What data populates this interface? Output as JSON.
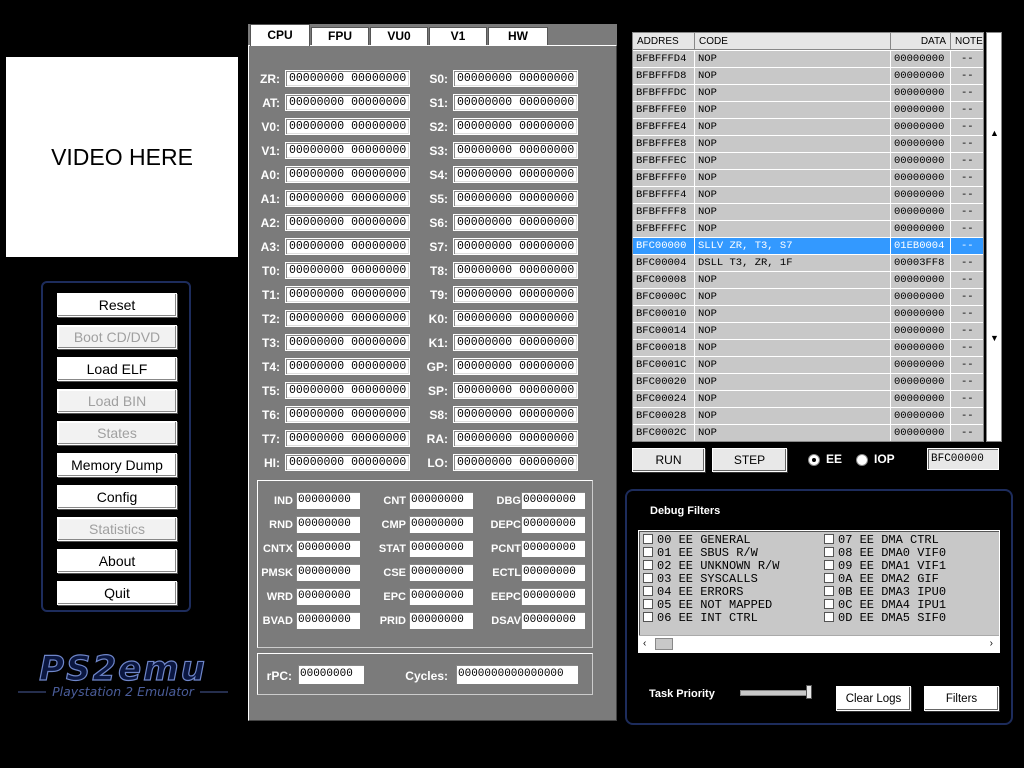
{
  "video": {
    "placeholder": "VIDEO HERE"
  },
  "menu": {
    "reset": "Reset",
    "boot_cd": "Boot CD/DVD",
    "load_elf": "Load ELF",
    "load_bin": "Load BIN",
    "states": "States",
    "memory_dump": "Memory Dump",
    "config": "Config",
    "statistics": "Statistics",
    "about": "About",
    "quit": "Quit"
  },
  "logo": {
    "title": "PS2emu",
    "subtitle": "Playstation 2 Emulator"
  },
  "tabs": [
    "CPU",
    "FPU",
    "VU0",
    "V1",
    "HW"
  ],
  "gpr_left": [
    {
      "label": "ZR:",
      "value": "00000000  00000000"
    },
    {
      "label": "AT:",
      "value": "00000000  00000000"
    },
    {
      "label": "V0:",
      "value": "00000000  00000000"
    },
    {
      "label": "V1:",
      "value": "00000000  00000000"
    },
    {
      "label": "A0:",
      "value": "00000000  00000000"
    },
    {
      "label": "A1:",
      "value": "00000000  00000000"
    },
    {
      "label": "A2:",
      "value": "00000000  00000000"
    },
    {
      "label": "A3:",
      "value": "00000000  00000000"
    },
    {
      "label": "T0:",
      "value": "00000000  00000000"
    },
    {
      "label": "T1:",
      "value": "00000000  00000000"
    },
    {
      "label": "T2:",
      "value": "00000000  00000000"
    },
    {
      "label": "T3:",
      "value": "00000000  00000000"
    },
    {
      "label": "T4:",
      "value": "00000000  00000000"
    },
    {
      "label": "T5:",
      "value": "00000000  00000000"
    },
    {
      "label": "T6:",
      "value": "00000000  00000000"
    },
    {
      "label": "T7:",
      "value": "00000000  00000000"
    },
    {
      "label": "HI:",
      "value": "00000000  00000000"
    }
  ],
  "gpr_right": [
    {
      "label": "S0:",
      "value": "00000000  00000000"
    },
    {
      "label": "S1:",
      "value": "00000000  00000000"
    },
    {
      "label": "S2:",
      "value": "00000000  00000000"
    },
    {
      "label": "S3:",
      "value": "00000000  00000000"
    },
    {
      "label": "S4:",
      "value": "00000000  00000000"
    },
    {
      "label": "S5:",
      "value": "00000000  00000000"
    },
    {
      "label": "S6:",
      "value": "00000000  00000000"
    },
    {
      "label": "S7:",
      "value": "00000000  00000000"
    },
    {
      "label": "T8:",
      "value": "00000000  00000000"
    },
    {
      "label": "T9:",
      "value": "00000000  00000000"
    },
    {
      "label": "K0:",
      "value": "00000000  00000000"
    },
    {
      "label": "K1:",
      "value": "00000000  00000000"
    },
    {
      "label": "GP:",
      "value": "00000000  00000000"
    },
    {
      "label": "SP:",
      "value": "00000000  00000000"
    },
    {
      "label": "S8:",
      "value": "00000000  00000000"
    },
    {
      "label": "RA:",
      "value": "00000000  00000000"
    },
    {
      "label": "LO:",
      "value": "00000000  00000000"
    }
  ],
  "cop0": [
    [
      {
        "label": "IND",
        "value": "00000000"
      },
      {
        "label": "CNT",
        "value": "00000000"
      },
      {
        "label": "DBG",
        "value": "00000000"
      }
    ],
    [
      {
        "label": "RND",
        "value": "00000000"
      },
      {
        "label": "CMP",
        "value": "00000000"
      },
      {
        "label": "DEPC",
        "value": "00000000"
      }
    ],
    [
      {
        "label": "CNTX",
        "value": "00000000"
      },
      {
        "label": "STAT",
        "value": "00000000"
      },
      {
        "label": "PCNT",
        "value": "00000000"
      }
    ],
    [
      {
        "label": "PMSK",
        "value": "00000000"
      },
      {
        "label": "CSE",
        "value": "00000000"
      },
      {
        "label": "ECTL",
        "value": "00000000"
      }
    ],
    [
      {
        "label": "WRD",
        "value": "00000000"
      },
      {
        "label": "EPC",
        "value": "00000000"
      },
      {
        "label": "EEPC",
        "value": "00000000"
      }
    ],
    [
      {
        "label": "BVAD",
        "value": "00000000"
      },
      {
        "label": "PRID",
        "value": "00000000"
      },
      {
        "label": "DSAV",
        "value": "00000000"
      }
    ]
  ],
  "status": {
    "rpc_label": "rPC:",
    "rpc": "00000000",
    "cycles_label": "Cycles:",
    "cycles": "0000000000000000"
  },
  "disasm": {
    "headers": [
      "ADDRES",
      "CODE",
      "DATA",
      "NOTE"
    ],
    "rows": [
      {
        "addr": "BFBFFFD4",
        "code": "NOP",
        "data": "00000000",
        "note": "--"
      },
      {
        "addr": "BFBFFFD8",
        "code": "NOP",
        "data": "00000000",
        "note": "--"
      },
      {
        "addr": "BFBFFFDC",
        "code": "NOP",
        "data": "00000000",
        "note": "--"
      },
      {
        "addr": "BFBFFFE0",
        "code": "NOP",
        "data": "00000000",
        "note": "--"
      },
      {
        "addr": "BFBFFFE4",
        "code": "NOP",
        "data": "00000000",
        "note": "--"
      },
      {
        "addr": "BFBFFFE8",
        "code": "NOP",
        "data": "00000000",
        "note": "--"
      },
      {
        "addr": "BFBFFFEC",
        "code": "NOP",
        "data": "00000000",
        "note": "--"
      },
      {
        "addr": "BFBFFFF0",
        "code": "NOP",
        "data": "00000000",
        "note": "--"
      },
      {
        "addr": "BFBFFFF4",
        "code": "NOP",
        "data": "00000000",
        "note": "--"
      },
      {
        "addr": "BFBFFFF8",
        "code": "NOP",
        "data": "00000000",
        "note": "--"
      },
      {
        "addr": "BFBFFFFC",
        "code": "NOP",
        "data": "00000000",
        "note": "--"
      },
      {
        "addr": "BFC00000",
        "code": "SLLV ZR, T3, S7",
        "data": "01EB0004",
        "note": "--",
        "selected": true
      },
      {
        "addr": "BFC00004",
        "code": "DSLL T3, ZR, 1F",
        "data": "00003FF8",
        "note": "--"
      },
      {
        "addr": "BFC00008",
        "code": "NOP",
        "data": "00000000",
        "note": "--"
      },
      {
        "addr": "BFC0000C",
        "code": "NOP",
        "data": "00000000",
        "note": "--"
      },
      {
        "addr": "BFC00010",
        "code": "NOP",
        "data": "00000000",
        "note": "--"
      },
      {
        "addr": "BFC00014",
        "code": "NOP",
        "data": "00000000",
        "note": "--"
      },
      {
        "addr": "BFC00018",
        "code": "NOP",
        "data": "00000000",
        "note": "--"
      },
      {
        "addr": "BFC0001C",
        "code": "NOP",
        "data": "00000000",
        "note": "--"
      },
      {
        "addr": "BFC00020",
        "code": "NOP",
        "data": "00000000",
        "note": "--"
      },
      {
        "addr": "BFC00024",
        "code": "NOP",
        "data": "00000000",
        "note": "--"
      },
      {
        "addr": "BFC00028",
        "code": "NOP",
        "data": "00000000",
        "note": "--"
      },
      {
        "addr": "BFC0002C",
        "code": "NOP",
        "data": "00000000",
        "note": "--"
      }
    ]
  },
  "controls": {
    "run": "RUN",
    "step": "STEP",
    "ee": "EE",
    "iop": "IOP",
    "selected_cpu": "EE",
    "pc": "BFC00000"
  },
  "debug": {
    "title": "Debug Filters",
    "filters_left": [
      "00 EE GENERAL",
      "01 EE SBUS R/W",
      "02 EE UNKNOWN R/W",
      "03 EE SYSCALLS",
      "04 EE ERRORS",
      "05 EE NOT MAPPED",
      "06 EE INT CTRL"
    ],
    "filters_right": [
      "07 EE DMA CTRL",
      "08 EE DMA0 VIF0",
      "09 EE DMA1 VIF1",
      "0A EE DMA2 GIF",
      "0B EE DMA3 IPU0",
      "0C EE DMA4 IPU1",
      "0D EE DMA5 SIF0"
    ],
    "task_priority": "Task Priority",
    "clear_logs": "Clear Logs",
    "filters_btn": "Filters"
  }
}
